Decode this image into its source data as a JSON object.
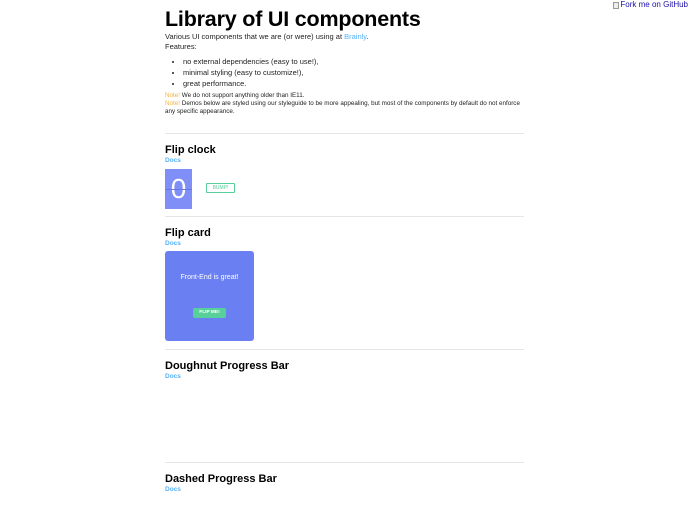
{
  "fork": {
    "label": "Fork me on GitHub",
    "icon": "broken-image-icon"
  },
  "header": {
    "title": "Library of UI components",
    "intro_prefix": "Various UI components that we are (or were) using at ",
    "intro_link": "Brainly",
    "intro_suffix": ".",
    "features_label": "Features:",
    "features": [
      "no external dependencies (easy to use!),",
      "minimal styling (easy to customize!),",
      "great performance."
    ],
    "note1_label": "Note!",
    "note1_text": " We do not support anything older than IE11.",
    "note2_label": "Note!",
    "note2_text": " Demos below are styled using our styleguide to be more appealing, but most of the components by default do not enforce any specific appearance."
  },
  "sections": {
    "flip_clock": {
      "title": "Flip clock",
      "docs": "Docs",
      "digit": "0",
      "bump_label": "BUMP!"
    },
    "flip_card": {
      "title": "Flip card",
      "docs": "Docs",
      "front_text": "Front-End is great!",
      "flip_label": "FLIP ME!"
    },
    "doughnut": {
      "title": "Doughnut Progress Bar",
      "docs": "Docs"
    },
    "dashed": {
      "title": "Dashed Progress Bar",
      "docs": "Docs"
    }
  },
  "colors": {
    "link": "#57b2f8",
    "note": "#f4b13f",
    "clock_bg": "#7f8ff7",
    "card_bg": "#6a7ff2",
    "button_green": "#57d09a"
  }
}
